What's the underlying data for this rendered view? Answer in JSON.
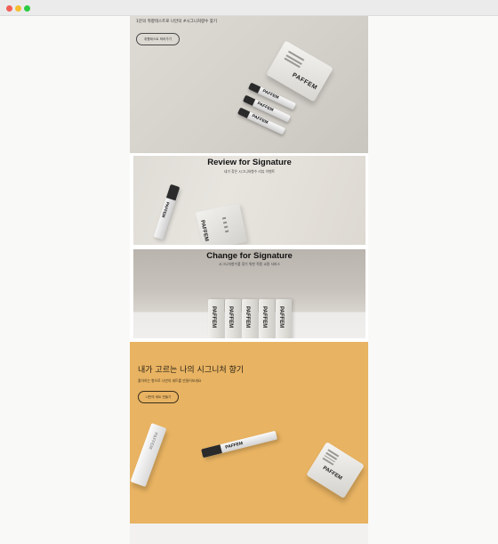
{
  "window": {
    "controls": {
      "close_color": "#f25f57",
      "minimize_color": "#f7bd2f",
      "maximize_color": "#2ccb42"
    }
  },
  "hero": {
    "tagline": "1분의 취향테스트로 나만의 #시그니처향수 찾기",
    "button_label": "취향테스트 하러가기",
    "product_brand": "PAFFEM"
  },
  "review": {
    "title": "Review for Signature",
    "subtitle": "내가 찾은 시그니처향수 리뷰 이벤트",
    "product_brand": "PAFFEM"
  },
  "change": {
    "title": "Change for Signature",
    "subtitle": "시그니처향수를 찾기 위한 적용 교환 서비스",
    "product_brand": "PAFFEM"
  },
  "custom": {
    "title": "내가 고르는 나의 시그니처 향기",
    "subtitle": "좋아하는 향으로 나만의 세트를 만들어보세요",
    "button_label": "나만의 세트 만들기",
    "product_brand": "PAFFEM",
    "accent_color": "#e8b362"
  }
}
